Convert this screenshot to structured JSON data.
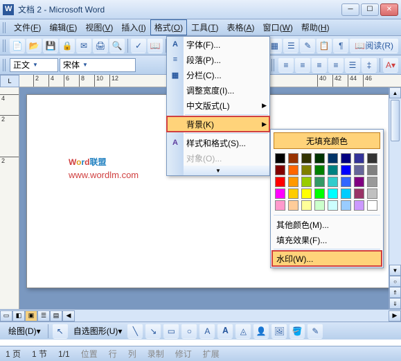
{
  "window": {
    "title": "文档 2 - Microsoft Word"
  },
  "menubar": {
    "items": [
      {
        "label": "文件",
        "key": "F"
      },
      {
        "label": "编辑",
        "key": "E"
      },
      {
        "label": "视图",
        "key": "V"
      },
      {
        "label": "插入",
        "key": "I"
      },
      {
        "label": "格式",
        "key": "O"
      },
      {
        "label": "工具",
        "key": "T"
      },
      {
        "label": "表格",
        "key": "A"
      },
      {
        "label": "窗口",
        "key": "W"
      },
      {
        "label": "帮助",
        "key": "H"
      }
    ]
  },
  "toolbar1": {
    "read_label": "阅读(R)"
  },
  "toolbar2": {
    "style_value": "正文",
    "font_value": "宋体"
  },
  "dropdown": {
    "items": [
      {
        "label": "字体(F)...",
        "icon": "A"
      },
      {
        "label": "段落(P)...",
        "icon": "≡"
      },
      {
        "label": "分栏(C)...",
        "icon": "▦"
      },
      {
        "label": "调整宽度(I)...",
        "icon": ""
      },
      {
        "label": "中文版式(L)",
        "icon": "",
        "submenu": true
      },
      {
        "label": "背景(K)",
        "icon": "",
        "submenu": true,
        "highlighted": true
      },
      {
        "label": "样式和格式(S)...",
        "icon": "A"
      },
      {
        "label": "对象(O)...",
        "icon": "",
        "disabled": true
      }
    ]
  },
  "submenu": {
    "nofill": "无填充颜色",
    "swatch_rows": [
      [
        "#000000",
        "#993300",
        "#333300",
        "#003300",
        "#003366",
        "#000080",
        "#333399",
        "#333333"
      ],
      [
        "#800000",
        "#ff6600",
        "#808000",
        "#008000",
        "#008080",
        "#0000ff",
        "#666699",
        "#808080"
      ],
      [
        "#ff0000",
        "#ff9900",
        "#99cc00",
        "#339966",
        "#33cccc",
        "#3366ff",
        "#800080",
        "#999999"
      ],
      [
        "#ff00ff",
        "#ffcc00",
        "#ffff00",
        "#00ff00",
        "#00ffff",
        "#00ccff",
        "#993366",
        "#c0c0c0"
      ],
      [
        "#ff99cc",
        "#ffcc99",
        "#ffff99",
        "#ccffcc",
        "#ccffff",
        "#99ccff",
        "#cc99ff",
        "#ffffff"
      ]
    ],
    "more_colors": "其他颜色(M)...",
    "fill_effects": "填充效果(F)...",
    "watermark": "水印(W)..."
  },
  "ruler": {
    "h_ticks": [
      2,
      4,
      6,
      8,
      10,
      12,
      40,
      42,
      44,
      46
    ],
    "v_ticks": [
      4,
      2,
      2
    ]
  },
  "watermark_overlay": {
    "line1_chars": [
      "W",
      "o",
      "r",
      "d",
      "联盟"
    ],
    "line2": "www.wordlm.com"
  },
  "drawbar": {
    "draw_label": "绘图(D)",
    "autoshape_label": "自选图形(U)"
  },
  "statusbar": {
    "page": "1 页",
    "section": "1 节",
    "pages": "1/1",
    "position": "位置",
    "line": "行",
    "col": "列",
    "rec": "录制",
    "rev": "修订",
    "ext": "扩展"
  }
}
